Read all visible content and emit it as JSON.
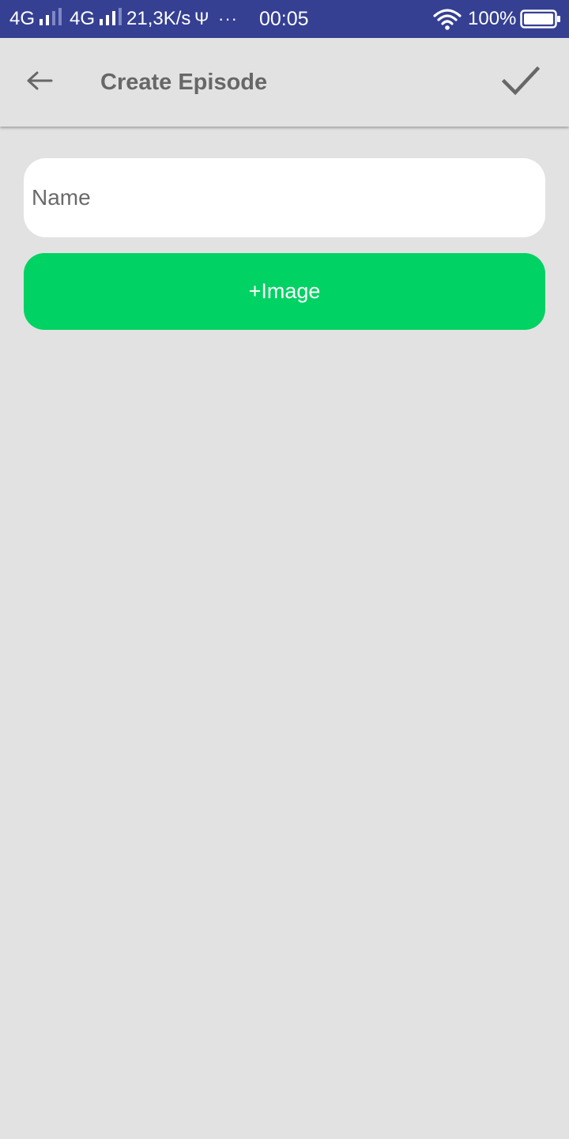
{
  "status_bar": {
    "network1": "4G",
    "network2": "4G",
    "speed": "21,3K/s",
    "usb_glyph": "Ψ",
    "more": "···",
    "time": "00:05",
    "battery": "100%",
    "icons": [
      "signal-icon",
      "signal-icon",
      "usb-icon",
      "wifi-icon",
      "battery-icon"
    ],
    "background": "#354093"
  },
  "app_bar": {
    "title": "Create Episode",
    "back_icon": "arrow-left-icon",
    "confirm_icon": "checkmark-icon"
  },
  "form": {
    "name_placeholder": "Name",
    "name_value": "",
    "image_button_label": "+Image",
    "accent_color": "#00d263"
  }
}
